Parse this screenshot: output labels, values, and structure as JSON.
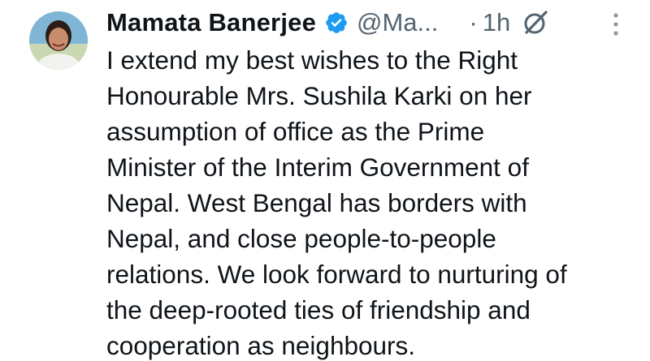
{
  "tweet": {
    "author_name": "Mamata Banerjee",
    "handle": "@Ma...",
    "separator": "·",
    "time": "1h",
    "text": "I extend my best wishes to the Right\nHonourable Mrs. Sushila Karki on her\nassumption of office as the Prime\nMinister of the Interim Government of\nNepal. West Bengal has borders with\nNepal, and close people-to-people\nrelations. We look forward to nurturing of\nthe deep-rooted ties of friendship and\ncooperation as neighbours."
  },
  "icons": {
    "verified": "verified-badge-icon",
    "grok": "grok-icon",
    "more": "more-vertical-icon"
  },
  "colors": {
    "verified_blue": "#1d9bf0",
    "secondary_text": "#536471",
    "primary_text": "#0f1419"
  }
}
